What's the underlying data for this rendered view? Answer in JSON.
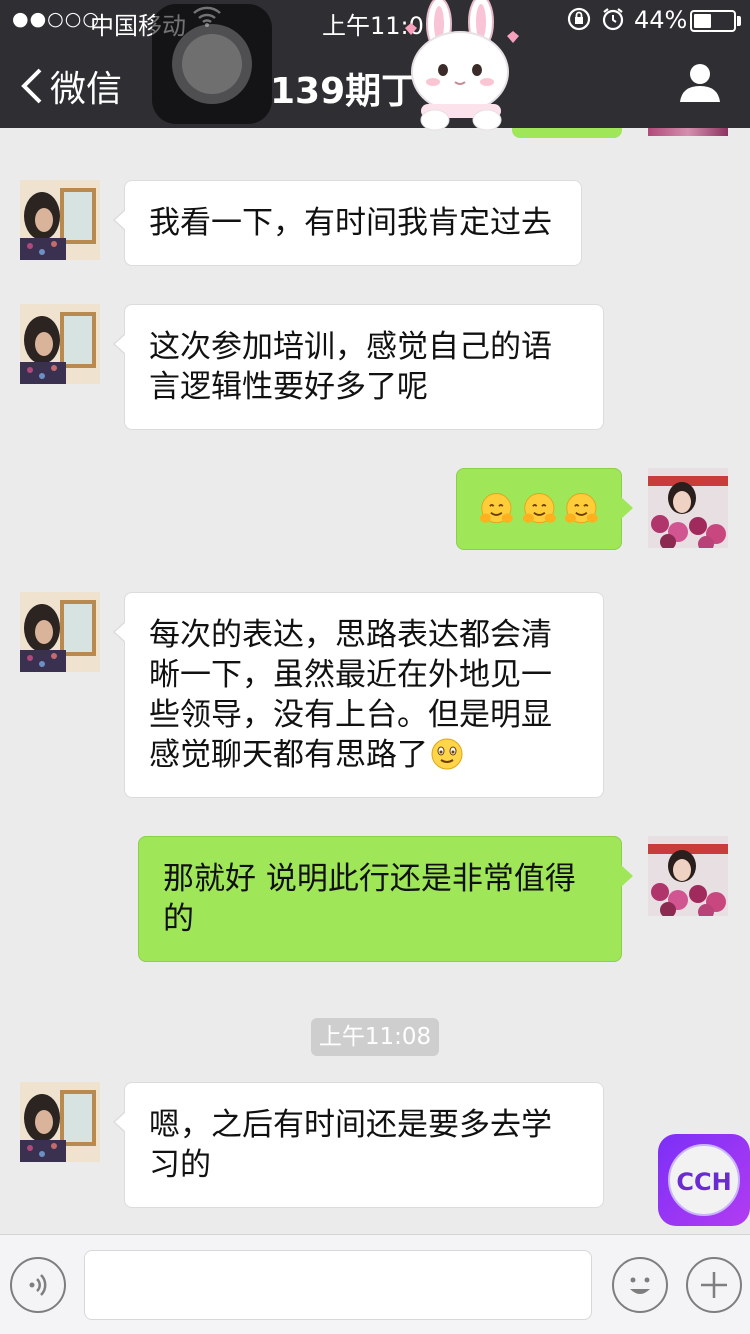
{
  "status_bar": {
    "signal": "●●○○○",
    "carrier": "中国移动",
    "time": "上午11:0",
    "battery_percent": "44%",
    "battery_level": 0.44,
    "icons": [
      "wifi-icon",
      "orientation-lock-icon",
      "alarm-icon",
      "battery-icon"
    ]
  },
  "nav": {
    "back_label": "微信",
    "title": "139期丁",
    "icons": [
      "chevron-left-icon",
      "person-icon"
    ]
  },
  "messages": [
    {
      "side": "left",
      "text": "我看一下，有时间我肯定过去"
    },
    {
      "side": "left",
      "text": "这次参加培训，感觉自己的语言逻辑性要好多了呢"
    },
    {
      "side": "right",
      "emoji": "hug-face-emoji",
      "emoji_count": 3
    },
    {
      "side": "left",
      "text": "每次的表达，思路表达都会清晰一下，虽然最近在外地见一些领导，没有上台。但是明显感觉聊天都有思路了",
      "trailing_emoji": "smiling-face-emoji"
    },
    {
      "side": "right",
      "text": "那就好 说明此行还是非常值得的"
    },
    {
      "side": "left",
      "text": "嗯，之后有时间还是要多去学习的"
    }
  ],
  "timestamp": "上午11:08",
  "cch_badge": "CCH",
  "toolbar": {
    "icons": [
      "voice-icon",
      "emoji-icon",
      "plus-icon"
    ],
    "input_value": ""
  },
  "colors": {
    "header_bg": "#2e2e33",
    "chat_bg": "#ebebeb",
    "sent_bubble": "#9fe658",
    "received_bubble": "#ffffff"
  }
}
